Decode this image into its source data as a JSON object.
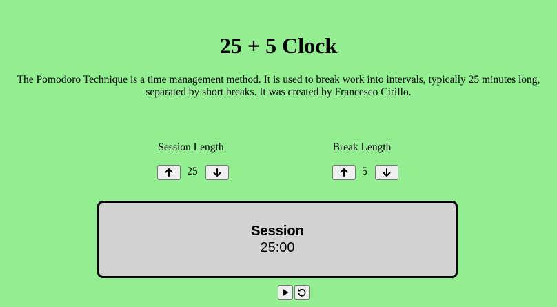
{
  "header": {
    "title": "25 + 5 Clock",
    "description": "The Pomodoro Technique is a time management method. It is used to break work into intervals, typically 25 minutes long, separated by short breaks. It was created by Francesco Cirillo."
  },
  "session": {
    "label": "Session Length",
    "value": "25",
    "increment_icon": "arrow-up-icon",
    "decrement_icon": "arrow-down-icon"
  },
  "break": {
    "label": "Break Length",
    "value": "5",
    "increment_icon": "arrow-up-icon",
    "decrement_icon": "arrow-down-icon"
  },
  "timer": {
    "label": "Session",
    "time": "25:00"
  },
  "controls": {
    "play_icon": "play-icon",
    "reset_icon": "reset-icon"
  },
  "colors": {
    "background": "#92ee90",
    "timer_background": "#d3d3d3",
    "timer_border": "#000000"
  }
}
